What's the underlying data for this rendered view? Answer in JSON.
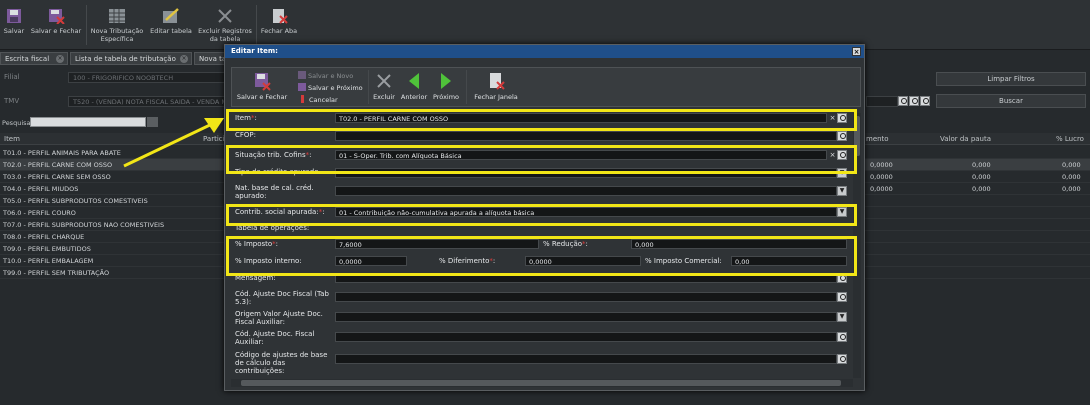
{
  "toolbar": {
    "save": "Salvar",
    "save_close": "Salvar e Fechar",
    "new_tributacao_1": "Nova Tributação",
    "new_tributacao_2": "Específica",
    "edit_table": "Editar tabela",
    "delete_records_1": "Excluir Registros",
    "delete_records_2": "da tabela",
    "close_tab": "Fechar Aba"
  },
  "tabs": [
    "Escrita fiscal",
    "Lista de tabela de tributação",
    "Nova ta"
  ],
  "filters": {
    "filial_label": "Filial",
    "filial_value": "100 - FRIGORIFICO NOOBTECH",
    "tmv_label": "TMV",
    "tmv_value": "T520 - (VENDA) NOTA FISCAL SAIDA - VENDA M",
    "clear_filters": "Limpar Filtros",
    "search_button": "Buscar",
    "search_label": "Pesquisar"
  },
  "grid": {
    "columns": {
      "item": "Item",
      "partial": "Particip",
      "amount": "mento",
      "pauta": "Valor da pauta",
      "profit": "% Lucro"
    },
    "rows": [
      {
        "item": "T01.0 - PERFIL ANIMAIS PARA ABATE",
        "c1": "",
        "c2": "",
        "c3": ""
      },
      {
        "item": "T02.0 - PERFIL CARNE COM OSSO",
        "c1": "0,0000",
        "c2": "0,000",
        "c3": "0,000"
      },
      {
        "item": "T03.0 - PERFIL CARNE SEM OSSO",
        "c1": "0,0000",
        "c2": "0,000",
        "c3": "0,000"
      },
      {
        "item": "T04.0 - PERFIL MIUDOS",
        "c1": "0,0000",
        "c2": "0,000",
        "c3": "0,000"
      },
      {
        "item": "T05.0 - PERFIL SUBPRODUTOS COMESTIVEIS",
        "c1": "",
        "c2": "",
        "c3": ""
      },
      {
        "item": "T06.0 - PERFIL COURO",
        "c1": "",
        "c2": "",
        "c3": ""
      },
      {
        "item": "T07.0 - PERFIL SUBPRODUTOS NAO COMESTIVEIS",
        "c1": "",
        "c2": "",
        "c3": ""
      },
      {
        "item": "T08.0 - PERFIL CHARQUE",
        "c1": "",
        "c2": "",
        "c3": ""
      },
      {
        "item": "T09.0 - PERFIL EMBUTIDOS",
        "c1": "",
        "c2": "",
        "c3": ""
      },
      {
        "item": "T10.0 - PERFIL EMBALAGEM",
        "c1": "",
        "c2": "",
        "c3": ""
      },
      {
        "item": "T99.0 - PERFIL SEM TRIBUTAÇÃO",
        "c1": "",
        "c2": "",
        "c3": ""
      }
    ]
  },
  "modal": {
    "title": "Editar Item:",
    "close": "×",
    "buttons": {
      "save_close": "Salvar e Fechar",
      "save_new": "Salvar e Novo",
      "save_next": "Salvar e Próximo",
      "cancel": "Cancelar",
      "delete": "Excluir",
      "previous": "Anterior",
      "next": "Próximo",
      "close_window": "Fechar Janela"
    },
    "fields": {
      "item_label": "Item",
      "item_value": "T02.0 - PERFIL CARNE COM OSSO",
      "cfop_label": "CFOP:",
      "sit_cofins_label": "Situação trib. Cofins",
      "sit_cofins_value": "01 - S-Oper. Trib. com Alíquota Básica",
      "tipo_credito_label": "Tipo de crédito apurado",
      "nat_base_label": "Nat. base de cal. créd. apurado:",
      "contrib_label": "Contrib. social apurada:",
      "contrib_value": "01 - Contribuição não-cumulativa apurada a alíquota básica",
      "tabela_op_label": "Tabela de operações:",
      "imposto_label": "% Imposto",
      "imposto_value": "7,6000",
      "reducao_label": "% Redução",
      "reducao_value": "0,000",
      "imposto_interno_label": "% Imposto interno:",
      "imposto_interno_value": "0,0000",
      "diferimento_label": "% Diferimento",
      "diferimento_value": "0,0000",
      "imposto_comercial_label": "% Imposto Comercial:",
      "imposto_comercial_value": "0,00",
      "mensagem_label": "Mensagem:",
      "cod_ajuste_label": "Cód. Ajuste Doc Fiscal (Tab 5.3):",
      "origem_label": "Origem Valor Ajuste Doc. Fiscal Auxiliar:",
      "cod_ajuste_aux_label": "Cód. Ajuste Doc. Fiscal Auxiliar:",
      "cod_ajustes_base_label": "Código de ajustes de base de cálculo das contribuições:",
      "required_mark": "*",
      "colon": ":"
    }
  },
  "colors": {
    "highlight": "#f2e617",
    "title_bar": "#1f4f8a",
    "required": "#e03c3c"
  }
}
